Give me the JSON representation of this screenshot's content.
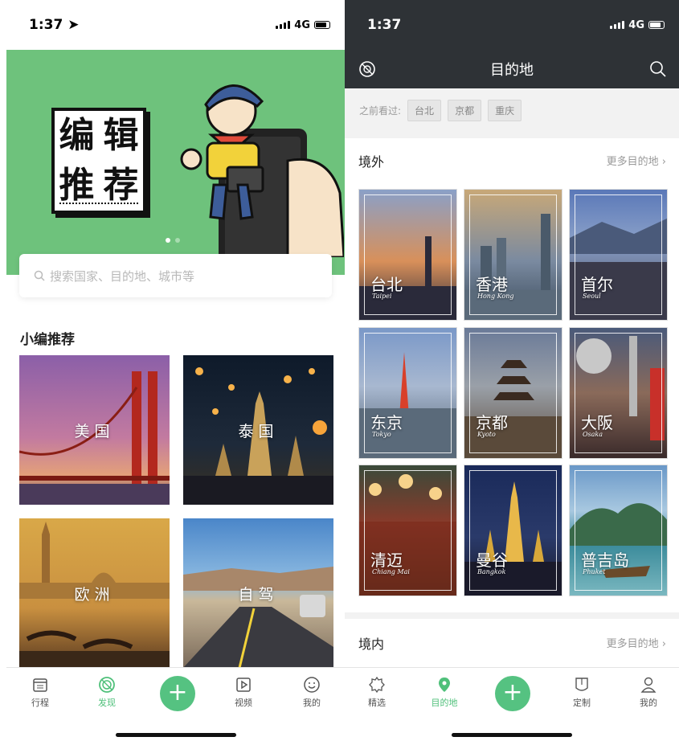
{
  "left_screen": {
    "status": {
      "time": "1:37",
      "network": "4G"
    },
    "banner": {
      "card_chars": [
        "编",
        "辑",
        "推",
        "荐"
      ],
      "page_dots": 2,
      "active_dot": 1
    },
    "search": {
      "placeholder": "搜索国家、目的地、城市等"
    },
    "section_title": "小编推荐",
    "recommendations": [
      {
        "label": "美国"
      },
      {
        "label": "泰国"
      },
      {
        "label": "欧洲"
      },
      {
        "label": "自驾"
      }
    ],
    "tabs": [
      {
        "label": "行程",
        "icon": "calendar-icon"
      },
      {
        "label": "发现",
        "icon": "discover-icon",
        "active": true
      },
      {
        "label": "",
        "icon": "plus-icon"
      },
      {
        "label": "视频",
        "icon": "video-icon"
      },
      {
        "label": "我的",
        "icon": "smile-icon"
      }
    ]
  },
  "right_screen": {
    "status": {
      "time": "1:37",
      "network": "4G"
    },
    "nav": {
      "title": "目的地"
    },
    "history": {
      "label": "之前看过:",
      "chips": [
        "台北",
        "京都",
        "重庆"
      ]
    },
    "overseas": {
      "title": "境外",
      "more": "更多目的地",
      "cities": [
        {
          "cn": "台北",
          "en": "Taipei"
        },
        {
          "cn": "香港",
          "en": "Hong Kong"
        },
        {
          "cn": "首尔",
          "en": "Seoul"
        },
        {
          "cn": "东京",
          "en": "Tokyo"
        },
        {
          "cn": "京都",
          "en": "Kyoto"
        },
        {
          "cn": "大阪",
          "en": "Osaka"
        },
        {
          "cn": "清迈",
          "en": "Chiang Mai"
        },
        {
          "cn": "曼谷",
          "en": "Bangkok"
        },
        {
          "cn": "普吉岛",
          "en": "Phuket"
        }
      ]
    },
    "domestic": {
      "title": "境内",
      "more": "更多目的地"
    },
    "tabs": [
      {
        "label": "精选",
        "icon": "badge-icon"
      },
      {
        "label": "目的地",
        "icon": "location-pin-icon",
        "active": true
      },
      {
        "label": "",
        "icon": "plus-icon"
      },
      {
        "label": "定制",
        "icon": "scroll-icon"
      },
      {
        "label": "我的",
        "icon": "person-icon"
      }
    ]
  },
  "colors": {
    "accent": "#55c281",
    "banner": "#6ec27c",
    "navbar": "#2e3236"
  }
}
